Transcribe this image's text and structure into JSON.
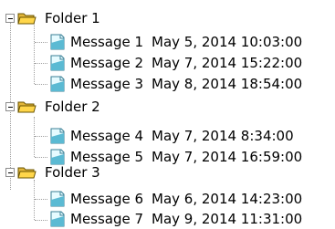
{
  "tree": {
    "folders": [
      {
        "label": "Folder 1",
        "messages": [
          {
            "label": "Message 1",
            "date": "May 5, 2014 10:03:00"
          },
          {
            "label": "Message 2",
            "date": "May 7, 2014 15:22:00"
          },
          {
            "label": "Message 3",
            "date": "May 8, 2014 18:54:00"
          }
        ]
      },
      {
        "label": "Folder 2",
        "messages": [
          {
            "label": "Message 4",
            "date": "May 7, 2014 8:34:00"
          },
          {
            "label": "Message 5",
            "date": "May 7, 2014 16:59:00"
          }
        ]
      },
      {
        "label": "Folder 3",
        "messages": [
          {
            "label": "Message 6",
            "date": "May 6, 2014 14:23:00"
          },
          {
            "label": "Message 7",
            "date": "May 9, 2014 11:31:00"
          }
        ]
      }
    ]
  },
  "colors": {
    "folder_fill": "#ffd64a",
    "folder_stroke": "#6a5400",
    "doc_fill": "#e6fbff",
    "doc_accent": "#5bbad3",
    "doc_stroke": "#3a7f96",
    "tree_line": "#a0a0a0"
  }
}
